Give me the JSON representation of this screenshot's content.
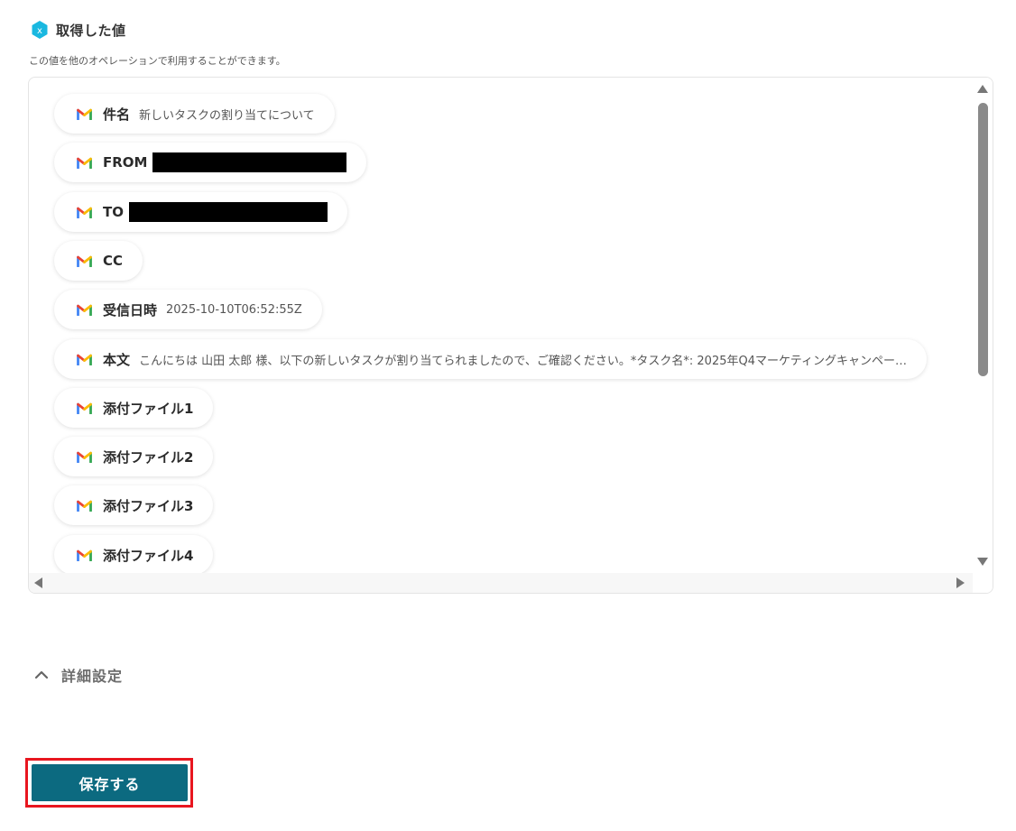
{
  "section": {
    "title": "取得した値",
    "badge_letter": "x",
    "description": "この値を他のオペレーションで利用することができます。"
  },
  "fields": [
    {
      "label": "件名",
      "value": "新しいタスクの割り当てについて",
      "icon": "gmail-icon"
    },
    {
      "label": "FROM",
      "value": "",
      "redacted": true,
      "icon": "gmail-icon"
    },
    {
      "label": "TO",
      "value": "",
      "redacted": true,
      "icon": "gmail-icon"
    },
    {
      "label": "CC",
      "value": "",
      "icon": "gmail-icon"
    },
    {
      "label": "受信日時",
      "value": "2025-10-10T06:52:55Z",
      "icon": "gmail-icon"
    },
    {
      "label": "本文",
      "value": "こんにちは 山田 太郎 様、以下の新しいタスクが割り当てられましたので、ご確認ください。*タスク名*: 2025年Q4マーケティングキャンペー…",
      "icon": "gmail-icon"
    },
    {
      "label": "添付ファイル1",
      "value": "",
      "icon": "gmail-icon"
    },
    {
      "label": "添付ファイル2",
      "value": "",
      "icon": "gmail-icon"
    },
    {
      "label": "添付ファイル3",
      "value": "",
      "icon": "gmail-icon"
    },
    {
      "label": "添付ファイル4",
      "value": "",
      "icon": "gmail-icon"
    }
  ],
  "details": {
    "label": "詳細設定",
    "icon": "chevron-up-icon"
  },
  "save_button": {
    "label": "保存する"
  },
  "colors": {
    "save_button_bg": "#0c6a80",
    "highlight_outline": "#e8161f",
    "badge": "#1ab8e0"
  }
}
